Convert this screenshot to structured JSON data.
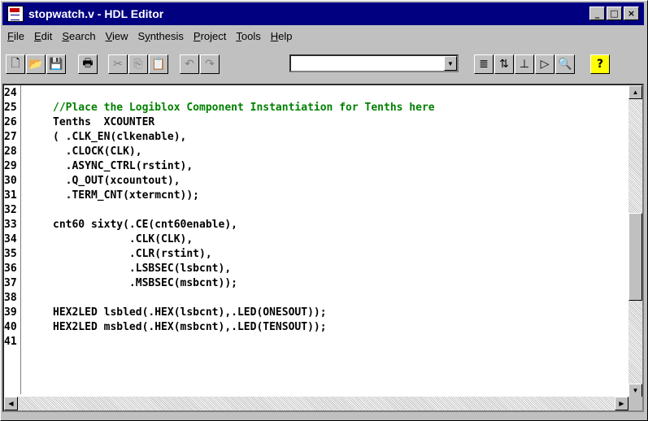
{
  "window": {
    "title": "stopwatch.v - HDL Editor"
  },
  "title_buttons": {
    "minimize": "_",
    "maximize": "□",
    "close": "×"
  },
  "menu": [
    {
      "pre": "",
      "u": "F",
      "post": "ile"
    },
    {
      "pre": "",
      "u": "E",
      "post": "dit"
    },
    {
      "pre": "",
      "u": "S",
      "post": "earch"
    },
    {
      "pre": "",
      "u": "V",
      "post": "iew"
    },
    {
      "pre": "S",
      "u": "y",
      "post": "nthesis"
    },
    {
      "pre": "",
      "u": "P",
      "post": "roject"
    },
    {
      "pre": "",
      "u": "T",
      "post": "ools"
    },
    {
      "pre": "",
      "u": "H",
      "post": "elp"
    }
  ],
  "toolbar": {
    "icons": [
      "new-file-icon",
      "open-folder-icon",
      "save-icon",
      "print-icon",
      "cut-icon",
      "copy-icon",
      "paste-icon",
      "undo-icon",
      "redo-icon",
      "language-assistant-icon",
      "synthesis-icon",
      "check-syntax-icon",
      "create-macro-icon",
      "find-icon",
      "help-icon"
    ],
    "glyphs": {
      "new": "🗋",
      "open": "📂",
      "save": "💾",
      "print": "🖶",
      "cut": "✂",
      "copy": "⎘",
      "paste": "📋",
      "undo": "↶",
      "redo": "↷",
      "t1": "≣",
      "t2": "⇅",
      "t3": "⊥",
      "t4": "▷",
      "t5": "🔍",
      "help": "?"
    },
    "combo_value": ""
  },
  "code_lines": [
    {
      "n": "24",
      "t": "",
      "comment": false
    },
    {
      "n": "25",
      "t": "//Place the Logiblox Component Instantiation for Tenths here",
      "comment": true
    },
    {
      "n": "26",
      "t": "Tenths  XCOUNTER",
      "comment": false
    },
    {
      "n": "27",
      "t": "( .CLK_EN(clkenable),",
      "comment": false
    },
    {
      "n": "28",
      "t": "  .CLOCK(CLK),",
      "comment": false
    },
    {
      "n": "29",
      "t": "  .ASYNC_CTRL(rstint),",
      "comment": false
    },
    {
      "n": "30",
      "t": "  .Q_OUT(xcountout),",
      "comment": false
    },
    {
      "n": "31",
      "t": "  .TERM_CNT(xtermcnt));",
      "comment": false
    },
    {
      "n": "32",
      "t": "",
      "comment": false
    },
    {
      "n": "33",
      "t": "cnt60 sixty(.CE(cnt60enable),",
      "comment": false
    },
    {
      "n": "34",
      "t": "            .CLK(CLK),",
      "comment": false
    },
    {
      "n": "35",
      "t": "            .CLR(rstint),",
      "comment": false
    },
    {
      "n": "36",
      "t": "            .LSBSEC(lsbcnt),",
      "comment": false
    },
    {
      "n": "37",
      "t": "            .MSBSEC(msbcnt));",
      "comment": false
    },
    {
      "n": "38",
      "t": "",
      "comment": false
    },
    {
      "n": "39",
      "t": "HEX2LED lsbled(.HEX(lsbcnt),.LED(ONESOUT));",
      "comment": false
    },
    {
      "n": "40",
      "t": "HEX2LED msbled(.HEX(msbcnt),.LED(TENSOUT));",
      "comment": false
    },
    {
      "n": "41",
      "t": "",
      "comment": false
    }
  ],
  "colors": {
    "comment": "#008000",
    "titlebar": "#000080"
  },
  "scroll": {
    "vertical_position": 0.58
  }
}
